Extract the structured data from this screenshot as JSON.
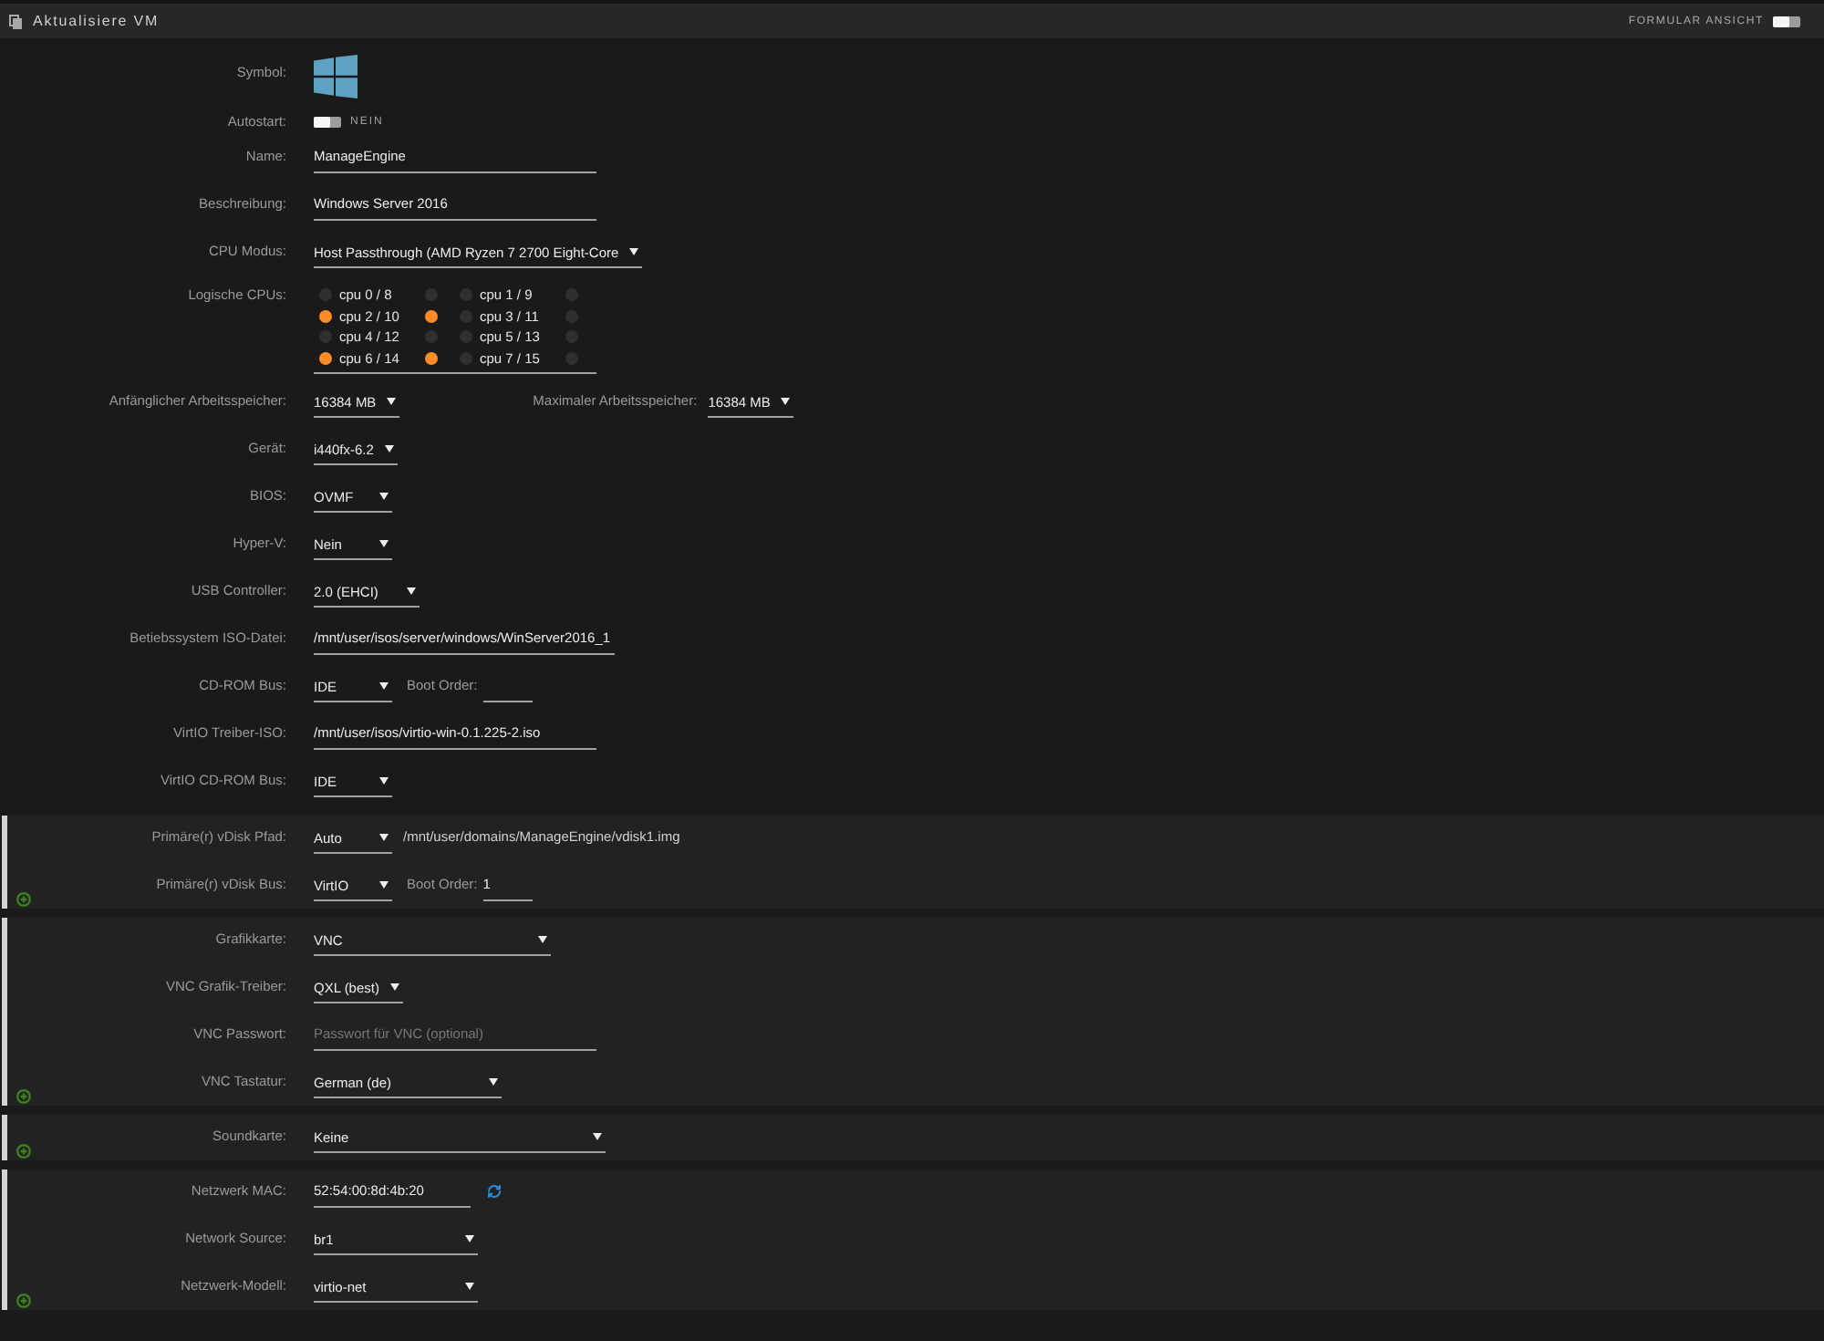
{
  "header": {
    "title": "Aktualisiere VM",
    "view_toggle": {
      "label": "FORMULAR ANSICHT",
      "on": false
    }
  },
  "form": {
    "rows": [
      {
        "kind": "icon",
        "label": "Symbol:"
      },
      {
        "kind": "toggle",
        "label": "Autostart:",
        "on": false,
        "state_text": "NEIN"
      },
      {
        "kind": "text",
        "label": "Name:",
        "value": "ManageEngine"
      },
      {
        "kind": "text",
        "label": "Beschreibung:",
        "value": "Windows Server 2016"
      },
      {
        "kind": "select",
        "label": "CPU Modus:",
        "value": "Host Passthrough (AMD Ryzen 7 2700 Eight-Core"
      },
      {
        "kind": "cpus",
        "label": "Logische CPUs:",
        "cpus": [
          {
            "label": "cpu 0 / 8",
            "threads": [
              {
                "checked": false
              },
              {
                "checked": false
              }
            ]
          },
          {
            "label": "cpu 1 / 9",
            "threads": [
              {
                "checked": false
              },
              {
                "checked": false
              }
            ]
          },
          {
            "label": "cpu 2 / 10",
            "threads": [
              {
                "checked": true
              },
              {
                "checked": true
              }
            ]
          },
          {
            "label": "cpu 3 / 11",
            "threads": [
              {
                "checked": false
              },
              {
                "checked": false
              }
            ]
          },
          {
            "label": "cpu 4 / 12",
            "threads": [
              {
                "checked": false
              },
              {
                "checked": false
              }
            ]
          },
          {
            "label": "cpu 5 / 13",
            "threads": [
              {
                "checked": false
              },
              {
                "checked": false
              }
            ]
          },
          {
            "label": "cpu 6 / 14",
            "threads": [
              {
                "checked": true
              },
              {
                "checked": true
              }
            ]
          },
          {
            "label": "cpu 7 / 15",
            "threads": [
              {
                "checked": false
              },
              {
                "checked": false
              }
            ]
          }
        ]
      },
      {
        "kind": "select",
        "label": "Anfänglicher Arbeitsspeicher:",
        "value": "16384 MB",
        "second": {
          "label": "Maximaler Arbeitsspeicher:",
          "value": "16384 MB"
        }
      },
      {
        "kind": "select",
        "label": "Gerät:",
        "value": "i440fx-6.2"
      },
      {
        "kind": "select",
        "label": "BIOS:",
        "value": "OVMF"
      },
      {
        "kind": "select",
        "label": "Hyper-V:",
        "value": "Nein"
      },
      {
        "kind": "select",
        "label": "USB Controller:",
        "value": "2.0 (EHCI)"
      },
      {
        "kind": "text",
        "label": "Betiebssystem ISO-Datei:",
        "value": "/mnt/user/isos/server/windows/WinServer2016_1"
      },
      {
        "kind": "select",
        "label": "CD-ROM Bus:",
        "value": "IDE",
        "boot_order": {
          "label": "Boot Order:"
        }
      },
      {
        "kind": "text",
        "label": "VirtIO Treiber-ISO:",
        "value": "/mnt/user/isos/virtio-win-0.1.225-2.iso"
      },
      {
        "kind": "select",
        "label": "VirtIO CD-ROM Bus:",
        "value": "IDE"
      }
    ]
  },
  "sections": [
    {
      "rows": [
        {
          "kind": "select",
          "label": "Primäre(r) vDisk Pfad:",
          "value": "Auto",
          "path": "/mnt/user/domains/ManageEngine/vdisk1.img"
        },
        {
          "kind": "select",
          "label": "Primäre(r) vDisk Bus:",
          "value": "VirtIO",
          "boot_order": {
            "label": "Boot Order:",
            "value": "1"
          }
        }
      ]
    },
    {
      "rows": [
        {
          "kind": "select",
          "label": "Grafikkarte:",
          "value": "VNC"
        },
        {
          "kind": "select",
          "label": "VNC Grafik-Treiber:",
          "value": "QXL (best)"
        },
        {
          "kind": "text",
          "label": "VNC Passwort:",
          "placeholder": "Passwort für VNC (optional)"
        },
        {
          "kind": "select",
          "label": "VNC Tastatur:",
          "value": "German (de)"
        }
      ]
    },
    {
      "rows": [
        {
          "kind": "select",
          "label": "Soundkarte:",
          "value": "Keine"
        }
      ]
    },
    {
      "rows": [
        {
          "kind": "text",
          "label": "Netzwerk MAC:",
          "value": "52:54:00:8d:4b:20",
          "refresh": true
        },
        {
          "kind": "select",
          "label": "Network Source:",
          "value": "br1"
        },
        {
          "kind": "select",
          "label": "Netzwerk-Modell:",
          "value": "virtio-net"
        }
      ]
    }
  ]
}
